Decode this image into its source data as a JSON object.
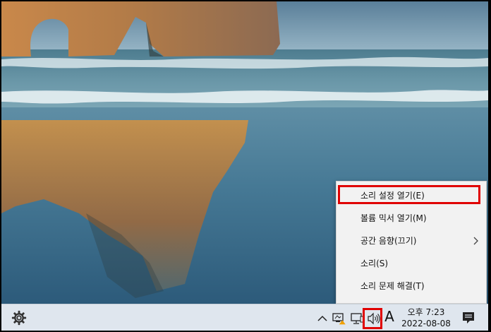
{
  "context_menu": {
    "items": [
      {
        "label": "소리 설정 열기(E)"
      },
      {
        "label": "볼륨 믹서 열기(M)"
      },
      {
        "label": "공간 음향(끄기)",
        "submenu_glyph": ">"
      },
      {
        "label": "소리(S)"
      },
      {
        "label": "소리 문제 해결(T)"
      }
    ]
  },
  "taskbar": {
    "tray": {
      "chevron_glyph": "^",
      "ime_indicator": "A"
    },
    "clock": {
      "time": "오후 7:23",
      "date": "2022-08-08"
    }
  },
  "icons": [
    "gear-icon",
    "chevron-up-icon",
    "network-warning-icon",
    "display-icon",
    "speaker-icon",
    "notification-icon"
  ],
  "colors": {
    "highlight": "#e00000",
    "menu_bg": "#f2f2f2",
    "taskbar_bg": "#dfe6ee"
  }
}
